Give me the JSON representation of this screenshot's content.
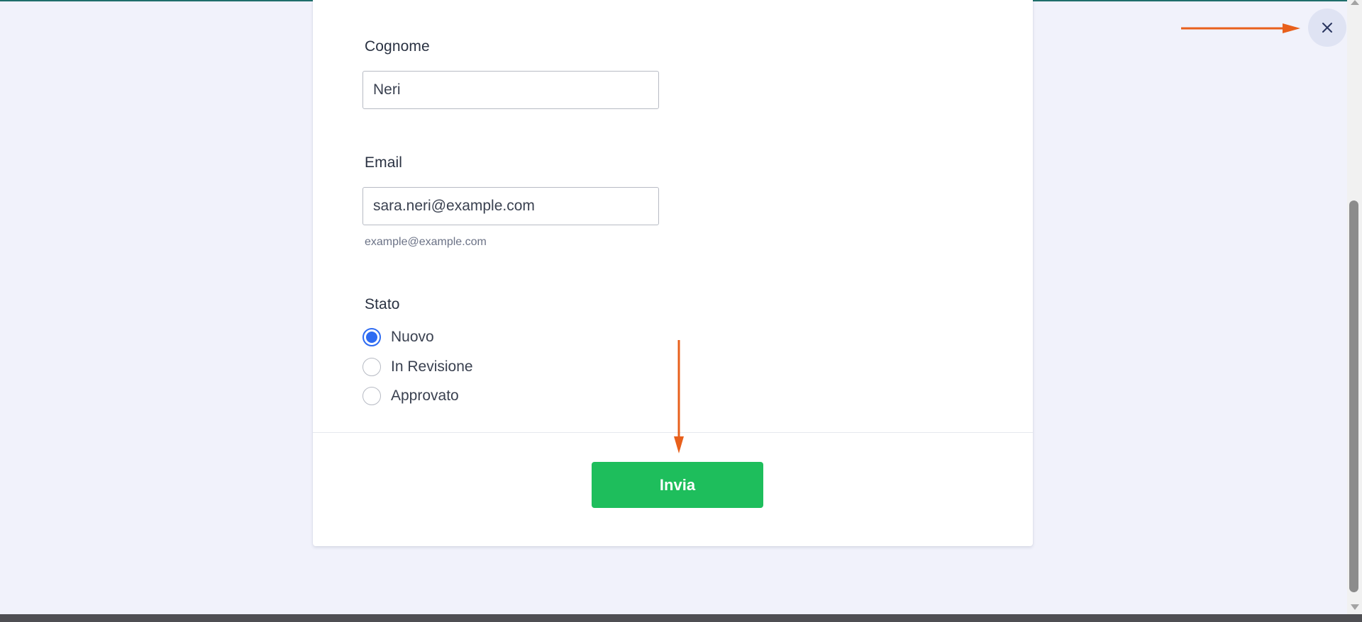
{
  "form": {
    "cognome": {
      "label": "Cognome",
      "value": "Neri"
    },
    "email": {
      "label": "Email",
      "value": "sara.neri@example.com",
      "helper": "example@example.com"
    },
    "stato": {
      "label": "Stato",
      "options": [
        "Nuovo",
        "In Revisione",
        "Approvato"
      ],
      "selected": "Nuovo"
    },
    "submit_label": "Invia"
  },
  "close_button": {
    "icon": "close-icon"
  },
  "colors": {
    "accent": "#2e6bf2",
    "submit": "#1ebe5c",
    "annotation_arrow": "#e8601c",
    "background": "#f1f2fb"
  }
}
